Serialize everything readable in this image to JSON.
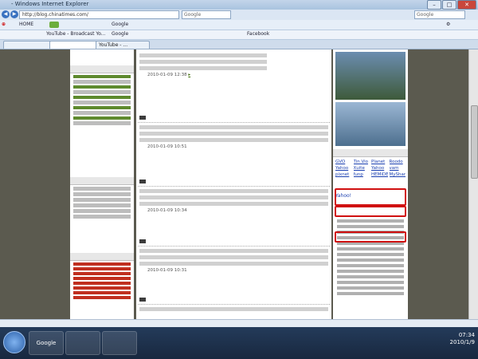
{
  "window": {
    "title": "",
    "browser_suffix": "Windows Internet Explorer"
  },
  "address": {
    "url": "http://blog.chinatimes.com/"
  },
  "search": {
    "engine": "Google"
  },
  "toolbar": {
    "google": "Google",
    "home_label": "HOME",
    "tab_label": ""
  },
  "favorites": [
    {
      "label": ""
    },
    {
      "label": "YouTube - Broadcast Yo..."
    },
    {
      "label": "Google"
    },
    {
      "label": ""
    },
    {
      "label": "Facebook"
    },
    {
      "label": ""
    },
    {
      "label": ""
    }
  ],
  "tabs": [
    {
      "label": ""
    },
    {
      "label": ""
    },
    {
      "label": "YouTube - ..."
    }
  ],
  "posts": [
    {
      "title": "",
      "meta": "2010-01-09 12:38"
    },
    {
      "title": "",
      "meta": "2010-01-09 10:51"
    },
    {
      "title": "",
      "meta": "2010-01-09 10:34"
    },
    {
      "title": "",
      "meta": "2010-01-09 10:31"
    },
    {
      "title": "",
      "meta": ""
    }
  ],
  "right": {
    "links": [
      "GVO",
      "Tin Vio",
      "Planet",
      "Roodo",
      "Yahoo",
      "Xuite",
      "Yahoo",
      "vam",
      "pixnet",
      "funp",
      "HEMiDEMi",
      "MyShare"
    ],
    "featured": [
      "Yahoo!",
      "",
      ""
    ]
  },
  "taskbar": {
    "apps": [
      "Google",
      "",
      ""
    ],
    "time": "07:34",
    "date": "2010/1/9"
  }
}
